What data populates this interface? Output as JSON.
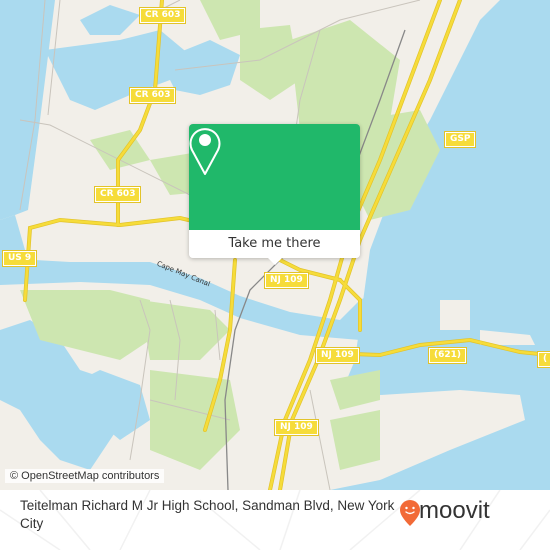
{
  "map": {
    "road_shields": [
      {
        "id": "cr603-a",
        "label": "CR 603"
      },
      {
        "id": "cr603-b",
        "label": "CR 603"
      },
      {
        "id": "cr603-c",
        "label": "CR 603"
      },
      {
        "id": "us9",
        "label": "US 9"
      },
      {
        "id": "gsp",
        "label": "GSP"
      },
      {
        "id": "nj109-a",
        "label": "NJ 109"
      },
      {
        "id": "nj109-b",
        "label": "NJ 109"
      },
      {
        "id": "nj109-c",
        "label": "NJ 109"
      },
      {
        "id": "cr621",
        "label": "(621)"
      },
      {
        "id": "cr621-edge",
        "label": "("
      }
    ],
    "water_label": "Cape May Canal",
    "attribution": "© OpenStreetMap contributors",
    "colors": {
      "water": "#aadaef",
      "land": "#f2efe9",
      "park": "#cde6b0",
      "road": "#f6dc3a",
      "popup": "#20b86a"
    }
  },
  "popup": {
    "icon": "location-pin-icon",
    "button_label": "Take me there"
  },
  "footer": {
    "address": "Teitelman Richard M Jr High School, Sandman Blvd, New York City",
    "logo_text": "moovit",
    "logo_color": "#f26a37"
  }
}
